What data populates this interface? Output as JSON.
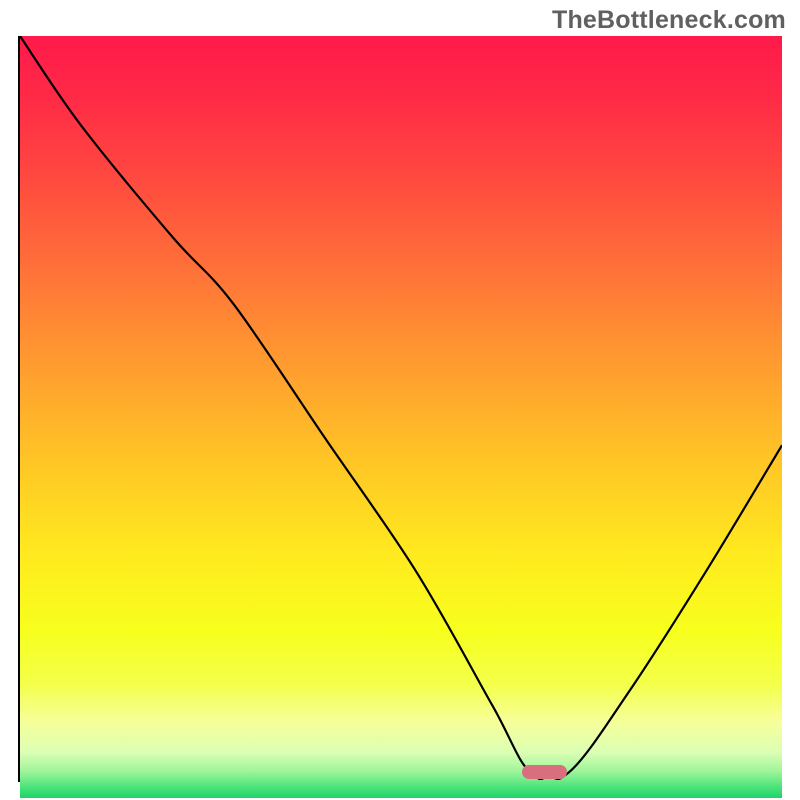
{
  "watermark": "TheBottleneck.com",
  "colors": {
    "frame": "#000000",
    "marker": "#d96e7e",
    "curve": "#000000",
    "gradient_stops": [
      {
        "offset": 0.0,
        "color": "#ff1a4b"
      },
      {
        "offset": 0.08,
        "color": "#ff2a46"
      },
      {
        "offset": 0.18,
        "color": "#ff4740"
      },
      {
        "offset": 0.3,
        "color": "#ff6f39"
      },
      {
        "offset": 0.42,
        "color": "#ff9830"
      },
      {
        "offset": 0.55,
        "color": "#ffc326"
      },
      {
        "offset": 0.68,
        "color": "#ffea1f"
      },
      {
        "offset": 0.78,
        "color": "#f7ff1d"
      },
      {
        "offset": 0.85,
        "color": "#f4ff4a"
      },
      {
        "offset": 0.9,
        "color": "#f6ff9a"
      },
      {
        "offset": 0.94,
        "color": "#dcffb4"
      },
      {
        "offset": 0.965,
        "color": "#9ef59a"
      },
      {
        "offset": 0.985,
        "color": "#4ee47c"
      },
      {
        "offset": 1.0,
        "color": "#1cd46a"
      }
    ]
  },
  "chart_data": {
    "type": "line",
    "title": "",
    "xlabel": "",
    "ylabel": "",
    "xlim": [
      0,
      100
    ],
    "ylim": [
      0,
      100
    ],
    "series": [
      {
        "name": "bottleneck-curve",
        "x": [
          0,
          8,
          20,
          28,
          40,
          52,
          62,
          67,
          72,
          80,
          90,
          100
        ],
        "y": [
          100,
          88,
          73,
          64,
          46,
          28,
          10,
          1,
          1,
          12,
          28,
          45
        ]
      }
    ],
    "marker": {
      "x_start": 66,
      "x_end": 72,
      "y": 0.5
    }
  }
}
